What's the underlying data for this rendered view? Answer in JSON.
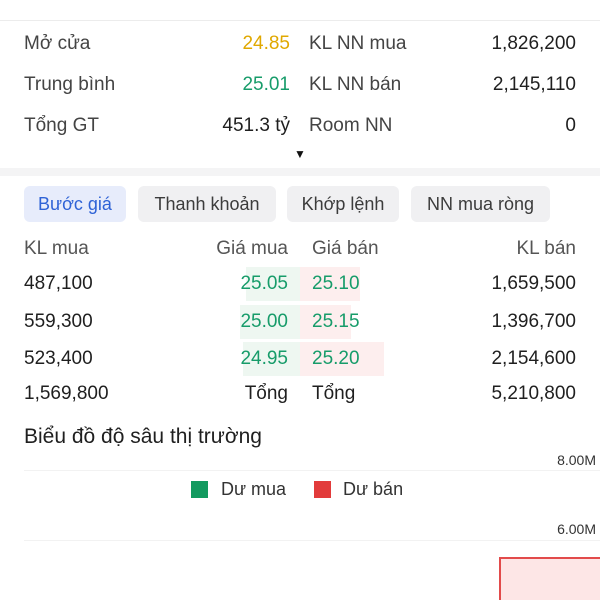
{
  "stats": [
    {
      "label": "Mở cửa",
      "value": "24.85",
      "value_color": "#e0a800",
      "label2": "KL NN mua",
      "value2": "1,826,200"
    },
    {
      "label": "Trung bình",
      "value": "25.01",
      "value_color": "#179c6a",
      "label2": "KL NN bán",
      "value2": "2,145,110"
    },
    {
      "label": "Tổng GT",
      "value": "451.3 tỷ",
      "value_color": "#1f1f1f",
      "label2": "Room NN",
      "value2": "0"
    }
  ],
  "expand_arrow": "▼",
  "tabs": [
    {
      "label": "Bước giá",
      "active": true
    },
    {
      "label": "Thanh khoản",
      "active": false
    },
    {
      "label": "Khớp lệnh",
      "active": false
    },
    {
      "label": "NN mua ròng",
      "active": false
    }
  ],
  "order_book": {
    "headers": {
      "kl_mua": "KL mua",
      "gia_mua": "Giá mua",
      "gia_ban": "Giá bán",
      "kl_ban": "KL bán"
    },
    "rows": [
      {
        "kl_mua": "487,100",
        "gia_mua": "25.05",
        "gia_ban": "25.10",
        "kl_ban": "1,659,500"
      },
      {
        "kl_mua": "559,300",
        "gia_mua": "25.00",
        "gia_ban": "25.15",
        "kl_ban": "1,396,700"
      },
      {
        "kl_mua": "523,400",
        "gia_mua": "24.95",
        "gia_ban": "25.20",
        "kl_ban": "2,154,600"
      }
    ],
    "total": {
      "kl_mua": "1,569,800",
      "gia_mua": "Tổng",
      "gia_ban": "Tổng",
      "kl_ban": "5,210,800"
    },
    "buy_bar_fill": [
      0.18,
      0.2,
      0.19
    ],
    "sell_bar_fill": [
      0.2,
      0.17,
      0.28
    ]
  },
  "depth_chart": {
    "title": "Biểu đồ độ sâu thị trường",
    "legend_buy": "Dư mua",
    "legend_sell": "Dư bán",
    "buy_color": "#139a5f",
    "sell_color": "#e23b3b",
    "y_ticks": [
      "8.00M",
      "6.00M"
    ]
  }
}
